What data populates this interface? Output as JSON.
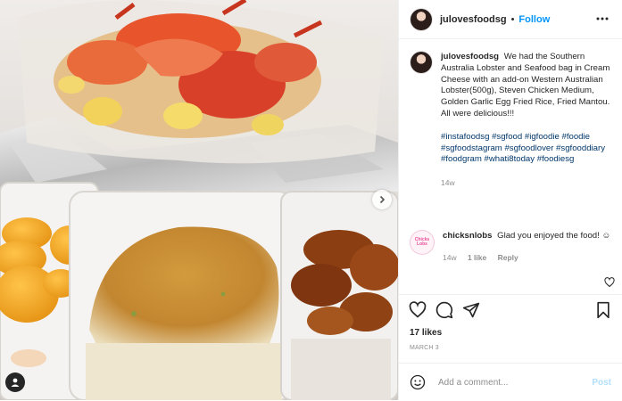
{
  "post": {
    "author": "julovesfoodsg",
    "follow_label": "Follow",
    "separator": "•",
    "caption_text": "We had the Southern Australia Lobster and Seafood bag in Cream Cheese with an add-on Western Australian Lobster(500g), Steven Chicken Medium, Golden Garlic Egg Fried Rice, Fried Mantou. All were delicious!!!",
    "hashtags": "#instafoodsg #sgfood #igfoodie #foodie #sgfoodstagram #sgfoodlover #sgfooddiary #foodgram #whati8today #foodiesg",
    "caption_age": "14w",
    "likes": "17 likes",
    "date": "MARCH 3"
  },
  "reply": {
    "author": "chicksnlobs",
    "text": "Glad you enjoyed the food! ☺",
    "age": "14w",
    "likes": "1 like",
    "reply_label": "Reply",
    "logo_text": "Chicks Lobs"
  },
  "add_comment": {
    "placeholder": "Add a comment...",
    "post_label": "Post"
  },
  "icons": {
    "like": "heart-icon",
    "comment": "comment-icon",
    "share": "share-icon",
    "save": "bookmark-icon",
    "emoji": "emoji-icon",
    "more": "more-dots-icon",
    "next": "chevron-right-icon",
    "tags": "user-tag-icon"
  },
  "colors": {
    "link_blue": "#0095f6",
    "hashtag": "#00376b",
    "muted": "#8e8e8e",
    "post_disabled": "#b2dffc"
  }
}
